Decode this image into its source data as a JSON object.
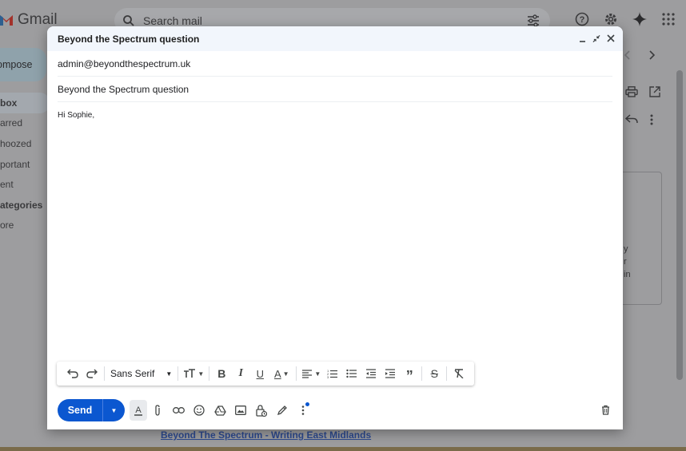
{
  "app": {
    "brand": "Gmail",
    "search_placeholder": "Search mail"
  },
  "sidebar": {
    "compose_label": "ompose",
    "items": [
      {
        "label": "box",
        "active": true
      },
      {
        "label": "arred"
      },
      {
        "label": "hoozed"
      },
      {
        "label": "portant"
      },
      {
        "label": "ent"
      },
      {
        "label": "ategories",
        "bold": true
      },
      {
        "label": "ore"
      }
    ]
  },
  "background": {
    "side_text_1": "y",
    "side_text_2": "r",
    "side_text_3": "in",
    "email_link": "Beyond The Spectrum - Writing East Midlands"
  },
  "compose": {
    "title": "Beyond the Spectrum question",
    "to": "admin@beyondthespectrum.uk",
    "subject": "Beyond the Spectrum question",
    "body": "Hi Sophie,",
    "font": "Sans Serif",
    "send_label": "Send"
  },
  "colors": {
    "send": "#0b57d0",
    "header": "#f2f6fc"
  }
}
